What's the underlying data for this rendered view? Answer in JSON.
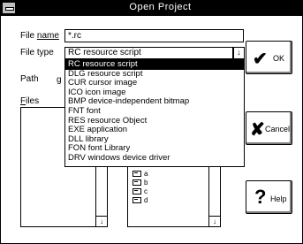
{
  "dialog": {
    "title": "Open Project"
  },
  "file_name": {
    "label_u": "File ",
    "label_rest": "name",
    "value": "*.rc"
  },
  "file_type": {
    "label": "File type",
    "selected": "RC resource script",
    "dropdown_arrow": "↓",
    "options": [
      "RC resource script",
      "DLG resource script",
      "CUR cursor image",
      "ICO icon image",
      "BMP device-independent bitmap",
      "FNT font",
      "RES resource Object",
      "EXE application",
      "DLL library",
      "FON font Library",
      "DRV windows device driver"
    ]
  },
  "path": {
    "label": "Path",
    "fragment": "g"
  },
  "files": {
    "label_u": "F",
    "label_rest": "iles"
  },
  "directories": {
    "items": [
      "a",
      "b",
      "c",
      "d"
    ]
  },
  "scroll": {
    "down": "↓"
  },
  "buttons": {
    "ok": {
      "label": "OK",
      "icon": "✔"
    },
    "cancel": {
      "label": "Cancel",
      "icon": "✘"
    },
    "help": {
      "label": "Help",
      "icon": "?"
    }
  }
}
